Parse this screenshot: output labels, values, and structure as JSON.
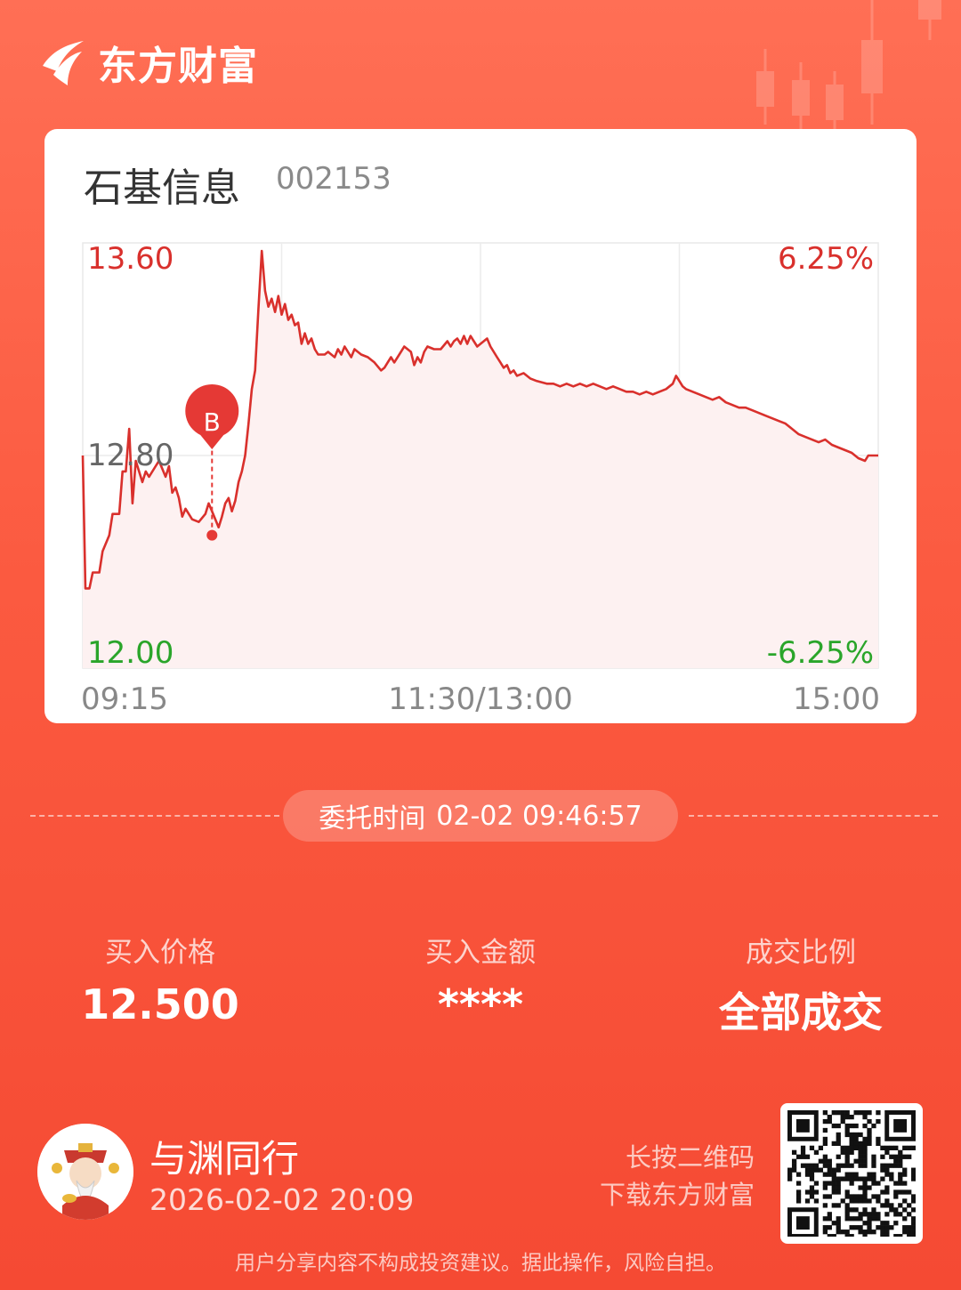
{
  "brand": {
    "name": "东方财富"
  },
  "stock": {
    "name": "石基信息",
    "code": "002153"
  },
  "chart_data": {
    "type": "line",
    "y_left_top": "13.60",
    "y_left_mid": "12.80",
    "y_left_bottom": "12.00",
    "y_right_top": "6.25%",
    "y_right_bottom": "-6.25%",
    "x_labels": [
      "09:15",
      "11:30/13:00",
      "15:00"
    ],
    "ylim": [
      12.0,
      13.6
    ],
    "x_range": [
      0,
      240
    ],
    "series": [
      {
        "color": "#d9302c",
        "points": [
          [
            0,
            12.8
          ],
          [
            0.8,
            12.3
          ],
          [
            2,
            12.3
          ],
          [
            3,
            12.36
          ],
          [
            5,
            12.36
          ],
          [
            6,
            12.44
          ],
          [
            8,
            12.5
          ],
          [
            9,
            12.58
          ],
          [
            11,
            12.58
          ],
          [
            12,
            12.74
          ],
          [
            13,
            12.74
          ],
          [
            14,
            12.9
          ],
          [
            15,
            12.62
          ],
          [
            16,
            12.78
          ],
          [
            18,
            12.7
          ],
          [
            19,
            12.74
          ],
          [
            20,
            12.72
          ],
          [
            22,
            12.76
          ],
          [
            23,
            12.78
          ],
          [
            25,
            12.72
          ],
          [
            26,
            12.76
          ],
          [
            27,
            12.66
          ],
          [
            28,
            12.68
          ],
          [
            29,
            12.64
          ],
          [
            30,
            12.57
          ],
          [
            31,
            12.6
          ],
          [
            33,
            12.56
          ],
          [
            35,
            12.55
          ],
          [
            37,
            12.58
          ],
          [
            38,
            12.62
          ],
          [
            39,
            12.59
          ],
          [
            40,
            12.56
          ],
          [
            41,
            12.53
          ],
          [
            42,
            12.57
          ],
          [
            43,
            12.62
          ],
          [
            44,
            12.64
          ],
          [
            45,
            12.59
          ],
          [
            46,
            12.63
          ],
          [
            47,
            12.7
          ],
          [
            48,
            12.74
          ],
          [
            49,
            12.8
          ],
          [
            50,
            12.92
          ],
          [
            51,
            13.05
          ],
          [
            52,
            13.12
          ],
          [
            53,
            13.35
          ],
          [
            54,
            13.57
          ],
          [
            55,
            13.42
          ],
          [
            56,
            13.36
          ],
          [
            57,
            13.39
          ],
          [
            58,
            13.34
          ],
          [
            59,
            13.4
          ],
          [
            60,
            13.33
          ],
          [
            61,
            13.37
          ],
          [
            62,
            13.31
          ],
          [
            63,
            13.33
          ],
          [
            64,
            13.29
          ],
          [
            65,
            13.3
          ],
          [
            66,
            13.22
          ],
          [
            67,
            13.26
          ],
          [
            68,
            13.22
          ],
          [
            69,
            13.24
          ],
          [
            70,
            13.2
          ],
          [
            71,
            13.18
          ],
          [
            73,
            13.18
          ],
          [
            74,
            13.19
          ],
          [
            76,
            13.17
          ],
          [
            77,
            13.2
          ],
          [
            78,
            13.18
          ],
          [
            79,
            13.21
          ],
          [
            80,
            13.19
          ],
          [
            81,
            13.17
          ],
          [
            82,
            13.2
          ],
          [
            84,
            13.18
          ],
          [
            86,
            13.17
          ],
          [
            88,
            13.15
          ],
          [
            90,
            13.12
          ],
          [
            91,
            13.13
          ],
          [
            92,
            13.15
          ],
          [
            93,
            13.17
          ],
          [
            94,
            13.15
          ],
          [
            96,
            13.19
          ],
          [
            97,
            13.21
          ],
          [
            99,
            13.19
          ],
          [
            100,
            13.14
          ],
          [
            101,
            13.17
          ],
          [
            102,
            13.15
          ],
          [
            103,
            13.19
          ],
          [
            104,
            13.21
          ],
          [
            106,
            13.2
          ],
          [
            108,
            13.2
          ],
          [
            110,
            13.23
          ],
          [
            111,
            13.21
          ],
          [
            112,
            13.23
          ],
          [
            113,
            13.24
          ],
          [
            114,
            13.22
          ],
          [
            115,
            13.25
          ],
          [
            116,
            13.22
          ],
          [
            117,
            13.25
          ],
          [
            118,
            13.23
          ],
          [
            119,
            13.21
          ],
          [
            120,
            13.22
          ],
          [
            122,
            13.24
          ],
          [
            123,
            13.21
          ],
          [
            125,
            13.17
          ],
          [
            126,
            13.15
          ],
          [
            127,
            13.13
          ],
          [
            128,
            13.14
          ],
          [
            129,
            13.11
          ],
          [
            130,
            13.12
          ],
          [
            131,
            13.1
          ],
          [
            133,
            13.11
          ],
          [
            135,
            13.09
          ],
          [
            137,
            13.08
          ],
          [
            140,
            13.07
          ],
          [
            142,
            13.07
          ],
          [
            144,
            13.06
          ],
          [
            146,
            13.07
          ],
          [
            148,
            13.06
          ],
          [
            150,
            13.07
          ],
          [
            152,
            13.06
          ],
          [
            154,
            13.07
          ],
          [
            156,
            13.06
          ],
          [
            158,
            13.05
          ],
          [
            160,
            13.06
          ],
          [
            162,
            13.05
          ],
          [
            164,
            13.04
          ],
          [
            166,
            13.04
          ],
          [
            168,
            13.03
          ],
          [
            170,
            13.04
          ],
          [
            172,
            13.03
          ],
          [
            174,
            13.04
          ],
          [
            176,
            13.05
          ],
          [
            178,
            13.07
          ],
          [
            179,
            13.1
          ],
          [
            180,
            13.08
          ],
          [
            181,
            13.06
          ],
          [
            182,
            13.05
          ],
          [
            184,
            13.04
          ],
          [
            186,
            13.03
          ],
          [
            188,
            13.02
          ],
          [
            190,
            13.01
          ],
          [
            192,
            13.02
          ],
          [
            194,
            13.0
          ],
          [
            196,
            12.99
          ],
          [
            198,
            12.98
          ],
          [
            200,
            12.98
          ],
          [
            202,
            12.97
          ],
          [
            204,
            12.96
          ],
          [
            206,
            12.95
          ],
          [
            208,
            12.94
          ],
          [
            210,
            12.93
          ],
          [
            212,
            12.92
          ],
          [
            214,
            12.9
          ],
          [
            216,
            12.88
          ],
          [
            218,
            12.87
          ],
          [
            220,
            12.86
          ],
          [
            222,
            12.85
          ],
          [
            224,
            12.86
          ],
          [
            226,
            12.84
          ],
          [
            228,
            12.83
          ],
          [
            230,
            12.82
          ],
          [
            232,
            12.81
          ],
          [
            234,
            12.79
          ],
          [
            236,
            12.78
          ],
          [
            237,
            12.8
          ],
          [
            238,
            12.8
          ],
          [
            240,
            12.8
          ]
        ]
      }
    ],
    "marker": {
      "label": "B",
      "x": 39,
      "price": 12.5
    }
  },
  "order": {
    "label": "委托时间",
    "time": "02-02 09:46:57"
  },
  "stats": [
    {
      "label": "买入价格",
      "value": "12.500"
    },
    {
      "label": "买入金额",
      "value": "****"
    },
    {
      "label": "成交比例",
      "value": "全部成交"
    }
  ],
  "user": {
    "name": "与渊同行",
    "time": "2026-02-02 20:09"
  },
  "qr_hint": {
    "line1": "长按二维码",
    "line2": "下载东方财富"
  },
  "disclaimer": "用户分享内容不构成投资建议。据此操作，风险自担。",
  "colors": {
    "up": "#d9302c",
    "down": "#2aa52a",
    "accent": "#fb5a40"
  }
}
